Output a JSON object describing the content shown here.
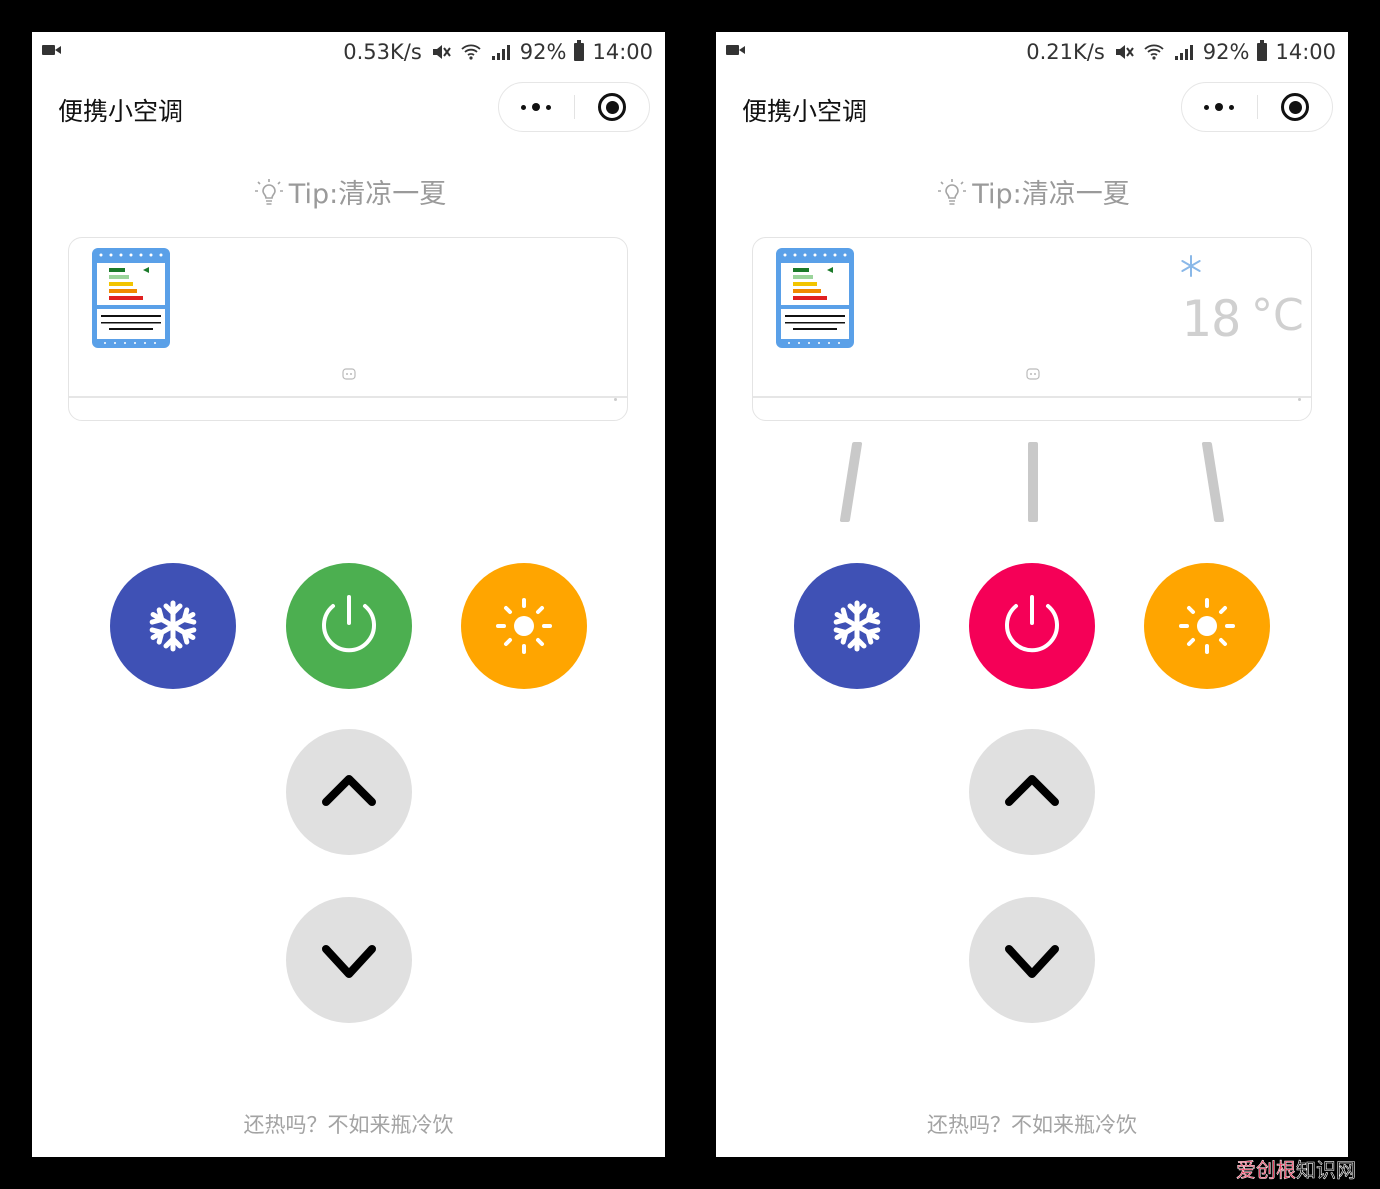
{
  "screens": [
    {
      "status": {
        "speed": "0.53K/s",
        "battery": "92%",
        "time": "14:00"
      },
      "nav": {
        "title": "便携小空调"
      },
      "tip": "Tip:清凉一夏",
      "ac": {
        "powered": false,
        "temperature": "",
        "unit": ""
      },
      "buttons": {
        "cool_color": "#3F51B5",
        "power_color": "#4CAF50",
        "heat_color": "#FFA500",
        "arrow_bg": "#E0E0E0"
      },
      "footer": "还热吗？不如来瓶冷饮"
    },
    {
      "status": {
        "speed": "0.21K/s",
        "battery": "92%",
        "time": "14:00"
      },
      "nav": {
        "title": "便携小空调"
      },
      "tip": "Tip:清凉一夏",
      "ac": {
        "powered": true,
        "mode_icon": "snowflake-icon",
        "temperature": "18",
        "unit": "°C"
      },
      "buttons": {
        "cool_color": "#3F51B5",
        "power_color": "#F50057",
        "heat_color": "#FFA500",
        "arrow_bg": "#E0E0E0"
      },
      "footer": "还热吗？不如来瓶冷饮"
    }
  ],
  "watermark": {
    "part_a": "爱创根",
    "part_b": "知识网"
  }
}
